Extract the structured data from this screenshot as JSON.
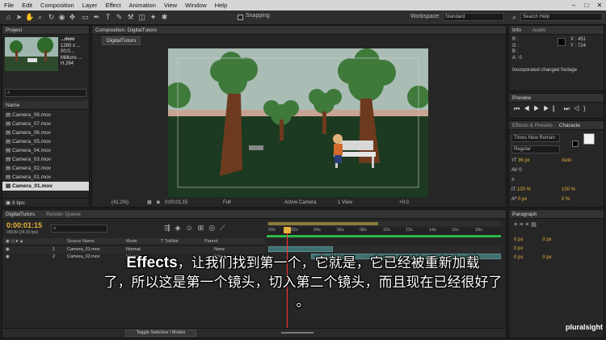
{
  "menu": [
    "File",
    "Edit",
    "Composition",
    "Layer",
    "Effect",
    "Animation",
    "View",
    "Window",
    "Help"
  ],
  "toolbar": {
    "snapping": "Snapping",
    "workspace_label": "Workspace:",
    "workspace_value": "Standard",
    "search_placeholder": "Search Help"
  },
  "project": {
    "tab": "Project",
    "file_name": "...mov",
    "file_info": [
      "1280 x ...",
      "00:0...",
      "Millions ...",
      "H.264"
    ],
    "column_name": "Name",
    "items": [
      "Camera_08.mov",
      "Camera_07.mov",
      "Camera_06.mov",
      "Camera_05.mov",
      "Camera_04.mov",
      "Camera_03.mov",
      "Camera_02.mov",
      "Camera_01.mov",
      "Camera_01.mov"
    ],
    "bpc": "8 bpc"
  },
  "composition": {
    "tab": "Composition: DigitalTutors",
    "subtab": "DigitalTutors",
    "zoom": "(41.2%)",
    "timecode": "0;00;01;15",
    "resolution": "Full",
    "camera": "Active Camera",
    "view": "1 View",
    "exposure": "+0.0"
  },
  "info": {
    "tab_info": "Info",
    "tab_audio": "Audio",
    "r": "R :",
    "g": "G :",
    "b": "B :",
    "a": "A : 0",
    "x": "X : 451",
    "y": "Y : 724",
    "message": "Incorporated changed footage"
  },
  "preview": {
    "tab": "Preview"
  },
  "effects": {
    "tab": "Effects & Presets",
    "char_tab": "Characte"
  },
  "character": {
    "font": "Times New Roman",
    "style": "Regular",
    "size": "36 px",
    "leading": "Auto",
    "kerning": "0",
    "scale_v": "100 %",
    "scale_h": "100 %",
    "baseline": "0 px",
    "tsume": "0 %"
  },
  "paragraph": {
    "tab": "Paragraph",
    "values": [
      "0 px",
      "0 px",
      "0 px",
      "0 px",
      "0 px"
    ]
  },
  "timeline": {
    "tab": "DigitalTutors",
    "render_tab": "Render Queue",
    "timecode": "0:00:01:15",
    "frames": "00039 (24.00 fps)",
    "columns": {
      "source": "Source Name",
      "mode": "Mode",
      "trkmat": "T  TrkMat",
      "parent": "Parent"
    },
    "layers": [
      {
        "num": "1",
        "name": "Camera_01.mov",
        "mode": "Normal",
        "parent": "None"
      },
      {
        "num": "2",
        "name": "Camera_02.mov",
        "mode": "Normal",
        "parent": "None"
      }
    ],
    "ruler": [
      "00s",
      "02s",
      "04s",
      "06s",
      "08s",
      "10s",
      "12s",
      "14s",
      "16s",
      "18s"
    ],
    "toggle": "Toggle Switches / Modes"
  },
  "subtitle": {
    "line1_eng": "Effects",
    "line1_cn": "，让我们找到第一个，它就是，它已经被重新加载",
    "line2": "了，所以这是第一个镜头，切入第二个镜头，而且现在已经很好了",
    "line3": "。"
  },
  "watermark": "pluralsight",
  "colors": {
    "accent": "#e8b23a",
    "timeline_bar": "#3f6f6f",
    "playhead": "#ff3333",
    "work_area": "#2fb84a"
  }
}
